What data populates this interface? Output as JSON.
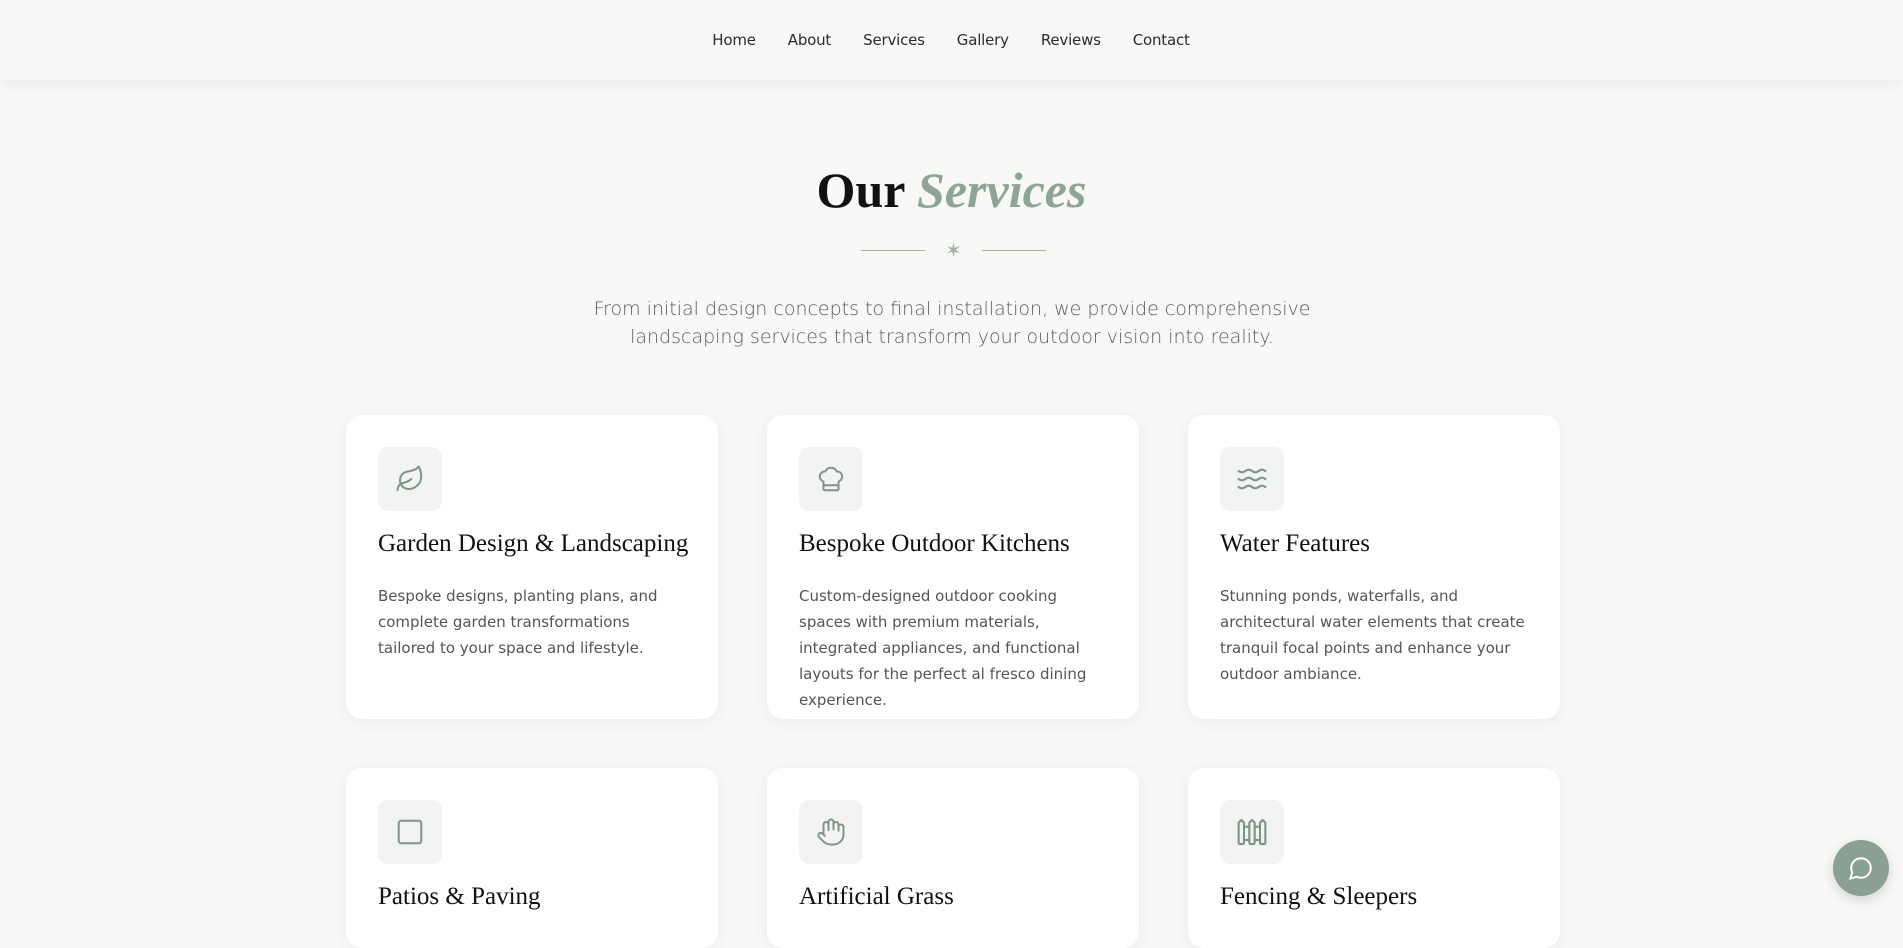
{
  "nav": {
    "items": [
      "Home",
      "About",
      "Services",
      "Gallery",
      "Reviews",
      "Contact"
    ]
  },
  "section": {
    "title_plain": "Our",
    "title_accent": "Services",
    "divider_glyph": "✶",
    "intro": "From initial design concepts to final installation, we provide comprehensive landscaping services that transform your outdoor vision into reality."
  },
  "services": [
    {
      "icon": "leaf-icon",
      "title": "Garden Design & Landscaping",
      "description": "Bespoke designs, planting plans, and complete garden transformations tailored to your space and lifestyle."
    },
    {
      "icon": "chef-hat-icon",
      "title": "Bespoke Outdoor Kitchens",
      "description": "Custom-designed outdoor cooking spaces with premium materials, integrated appliances, and functional layouts for the perfect al fresco dining experience."
    },
    {
      "icon": "waves-icon",
      "title": "Water Features",
      "description": "Stunning ponds, waterfalls, and architectural water elements that create tranquil focal points and enhance your outdoor ambiance."
    },
    {
      "icon": "square-icon",
      "title": "Patios & Paving",
      "description": ""
    },
    {
      "icon": "grass-hand-icon",
      "title": "Artificial Grass",
      "description": ""
    },
    {
      "icon": "fence-icon",
      "title": "Fencing & Sleepers",
      "description": ""
    }
  ],
  "chat": {
    "icon": "chat-bubble-icon"
  },
  "colors": {
    "accent": "#8ea494",
    "background": "#f8f8f7",
    "card": "#ffffff",
    "icon_bg": "#f2f4f3",
    "chat_button": "#8aa093"
  }
}
